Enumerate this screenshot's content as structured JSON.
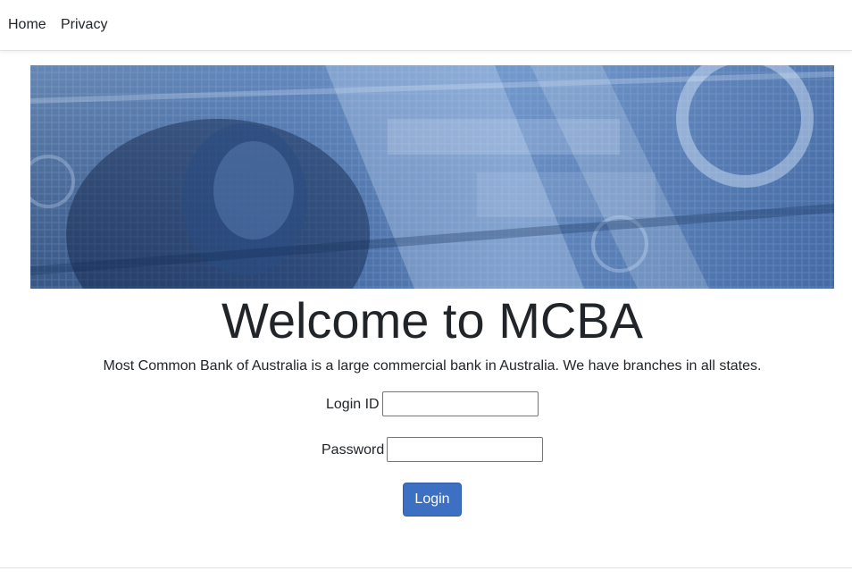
{
  "nav": {
    "items": [
      {
        "label": "Home"
      },
      {
        "label": "Privacy"
      }
    ]
  },
  "banner": {
    "image": "dollar-bills-banner",
    "colors": {
      "dark": "#23406f",
      "mid": "#3a62a1",
      "light": "#6f99d2"
    }
  },
  "main": {
    "title": "Welcome to MCBA",
    "tagline": "Most Common Bank of Australia is a large commercial bank in Australia. We have branches in all states."
  },
  "form": {
    "login_id_label": "Login ID",
    "login_id_value": "",
    "password_label": "Password",
    "password_value": "",
    "submit_label": "Login",
    "submit_color": "#3d70c2"
  }
}
